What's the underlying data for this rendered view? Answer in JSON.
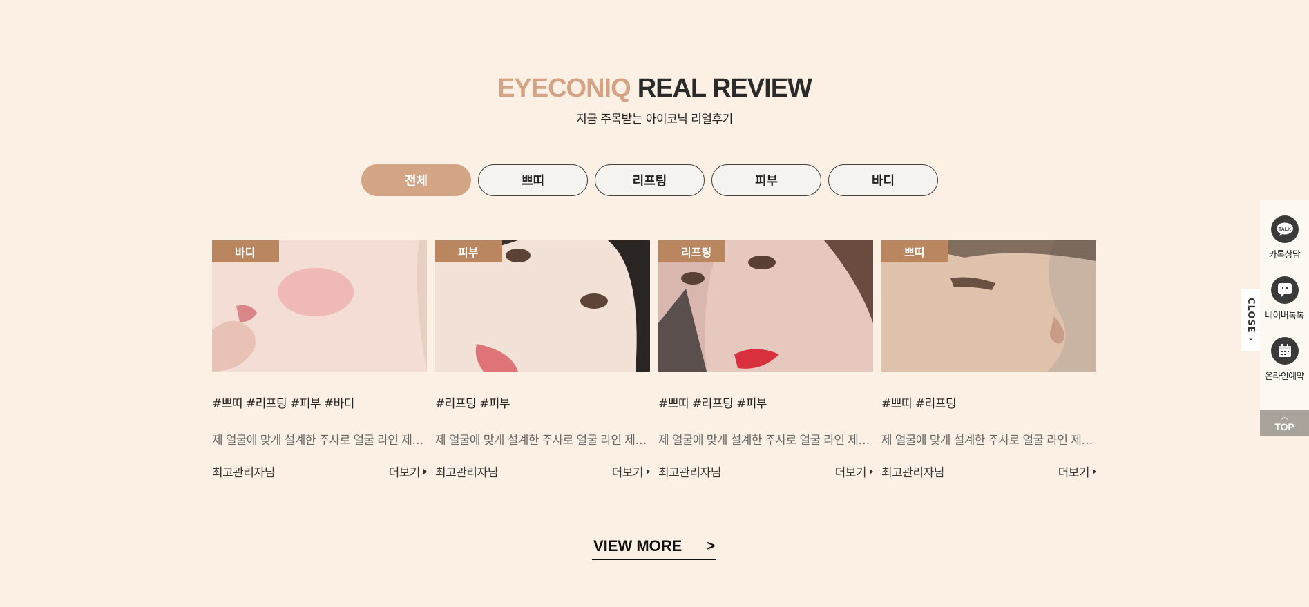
{
  "section": {
    "title_brand": "EYECONIQ",
    "title_rest": "REAL REVIEW",
    "subtitle": "지금 주목받는 아이코닉 리얼후기"
  },
  "tabs": [
    {
      "label": "전체",
      "active": true
    },
    {
      "label": "쁘띠",
      "active": false
    },
    {
      "label": "리프팅",
      "active": false
    },
    {
      "label": "피부",
      "active": false
    },
    {
      "label": "바디",
      "active": false
    }
  ],
  "reviews": [
    {
      "badge": "바디",
      "tags": "#쁘띠 #리프팅 #피부 #바디",
      "desc": "제 얼굴에 맞게 설계한 주사로 얼굴 라인 제대로 잡았어요",
      "author": "최고관리자님",
      "more": "더보기"
    },
    {
      "badge": "피부",
      "tags": "#리프팅 #피부",
      "desc": "제 얼굴에 맞게 설계한 주사로 얼굴 라인 제대로 잡았어요",
      "author": "최고관리자님",
      "more": "더보기"
    },
    {
      "badge": "리프팅",
      "tags": "#쁘띠 #리프팅 #피부",
      "desc": "제 얼굴에 맞게 설계한 주사로 얼굴 라인 제대로 잡았어요",
      "author": "최고관리자님",
      "more": "더보기"
    },
    {
      "badge": "쁘띠",
      "tags": "#쁘띠 #리프팅",
      "desc": "제 얼굴에 맞게 설계한 주사로 얼굴 라인 제대로 잡았어요",
      "author": "최고관리자님",
      "more": "더보기"
    }
  ],
  "view_more": {
    "label": "VIEW MORE",
    "arrow": ">"
  },
  "quick_menu": {
    "close_label": "CLOSE",
    "items": [
      {
        "label": "카톡상담",
        "icon": "talk-icon",
        "icon_text": "TALK"
      },
      {
        "label": "네이버톡톡",
        "icon": "naver-talk-icon"
      },
      {
        "label": "온라인예약",
        "icon": "calendar-icon"
      }
    ],
    "top_label": "TOP"
  },
  "colors": {
    "background": "#fbf0e3",
    "accent": "#d3a585",
    "badge": "#b98660"
  }
}
